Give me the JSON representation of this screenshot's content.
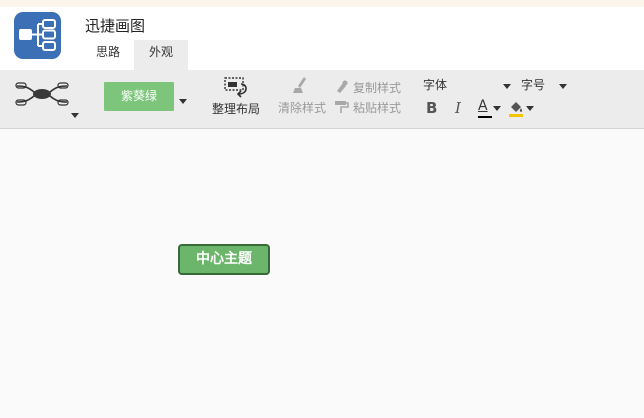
{
  "app": {
    "title": "迅捷画图",
    "logo_icon": "mindmap-logo-icon",
    "logo_color": "#3b6fb6"
  },
  "tabs": [
    {
      "label": "思路",
      "active": false
    },
    {
      "label": "外观",
      "active": true
    }
  ],
  "toolbar": {
    "structure_icon": "mindmap-structure-icon",
    "theme": {
      "label": "紫葵绿",
      "color": "#7cc57b"
    },
    "arrange_layout_label": "整理布局",
    "clear_style_label": "清除样式",
    "copy_style_label": "复制样式",
    "paste_style_label": "粘贴样式",
    "font_family_label": "字体",
    "font_size_label": "字号",
    "bold_label": "B",
    "italic_label": "I",
    "font_color_label": "A"
  },
  "canvas": {
    "central_topic": {
      "label": "中心主题",
      "color": "#6cb66b",
      "border_color": "#376a36"
    }
  }
}
